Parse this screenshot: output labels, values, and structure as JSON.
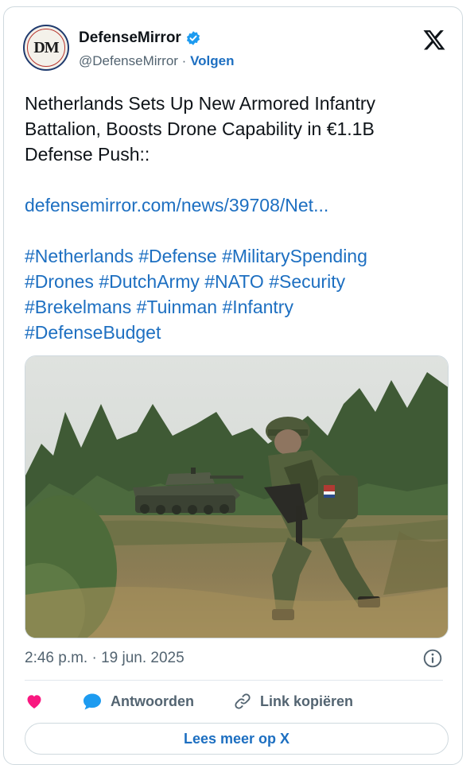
{
  "author": {
    "avatar_text": "DM",
    "display_name": "DefenseMirror",
    "handle": "@DefenseMirror",
    "separator": " · ",
    "follow_label": "Volgen",
    "verified_icon": "verified-badge-icon",
    "platform_icon": "x-logo-icon"
  },
  "tweet": {
    "text": "Netherlands Sets Up New Armored Infantry Battalion, Boosts Drone Capability in €1.1B Defense Push::",
    "link": "defensemirror.com/news/39708/Net...",
    "hashtags": [
      "#Netherlands",
      "#Defense",
      "#MilitarySpending",
      "#Drones",
      "#DutchArmy",
      "#NATO",
      "#Security",
      "#Brekelmans",
      "#Tuinman",
      "#Infantry",
      "#DefenseBudget"
    ]
  },
  "media": {
    "icon": "photo-soldier-and-armored-vehicle"
  },
  "meta": {
    "timestamp": "2:46 p.m. · 19 jun. 2025",
    "info_icon": "info-icon"
  },
  "actions": {
    "like_icon": "heart-icon",
    "reply_label": "Antwoorden",
    "reply_icon": "speech-bubble-icon",
    "copy_label": "Link kopiëren",
    "copy_icon": "link-icon"
  },
  "footer": {
    "read_more_label": "Lees meer op X"
  },
  "colors": {
    "accent": "#1d6fc1",
    "muted": "#536471",
    "heart": "#f91880",
    "verified": "#1d9bf0",
    "border": "#cfd9de"
  }
}
